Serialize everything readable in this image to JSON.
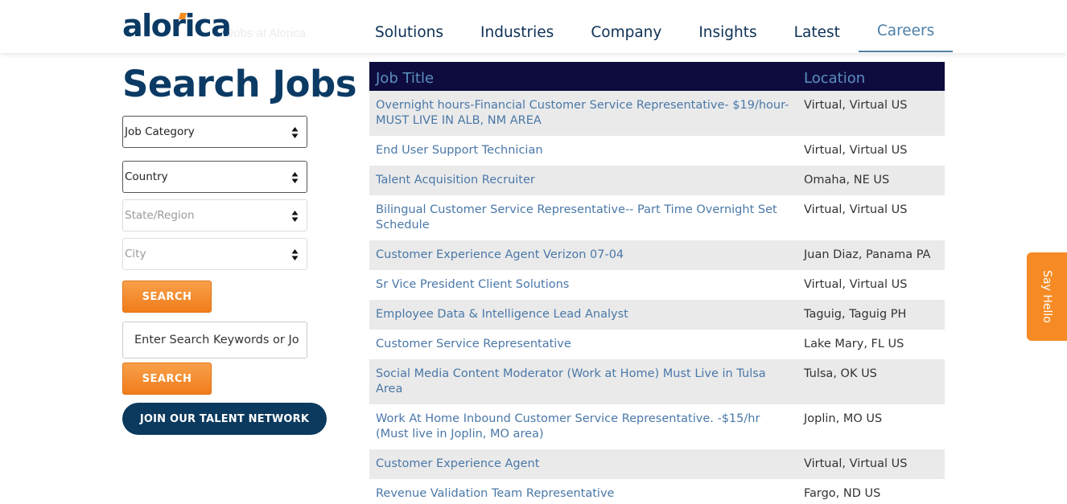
{
  "header": {
    "logo_text": "alorica",
    "ghost_text": "l Jobs at Alorica",
    "nav": [
      {
        "label": "Solutions",
        "active": false
      },
      {
        "label": "Industries",
        "active": false
      },
      {
        "label": "Company",
        "active": false
      },
      {
        "label": "Insights",
        "active": false
      },
      {
        "label": "Latest",
        "active": false
      },
      {
        "label": "Careers",
        "active": true
      }
    ]
  },
  "search": {
    "title": "Search Jobs",
    "job_category": "Job Category",
    "country": "Country",
    "state_region": "State/Region",
    "city": "City",
    "search_button_1": "SEARCH",
    "keyword_value": "Enter Search Keywords or Jo",
    "search_button_2": "SEARCH",
    "talent_button": "JOIN OUR TALENT NETWORK"
  },
  "table": {
    "headers": {
      "title": "Job Title",
      "location": "Location"
    },
    "rows": [
      {
        "title": "Overnight hours-Financial Customer Service Representative- $19/hour- MUST LIVE IN ALB, NM AREA",
        "location": "Virtual, Virtual US"
      },
      {
        "title": "End User Support Technician",
        "location": "Virtual, Virtual US"
      },
      {
        "title": "Talent Acquisition Recruiter",
        "location": "Omaha, NE US"
      },
      {
        "title": "Bilingual Customer Service Representative-- Part Time Overnight Set Schedule",
        "location": "Virtual, Virtual US"
      },
      {
        "title": "Customer Experience Agent Verizon 07-04",
        "location": "Juan Diaz, Panama PA"
      },
      {
        "title": "Sr Vice President Client Solutions",
        "location": "Virtual, Virtual US"
      },
      {
        "title": "Employee Data & Intelligence Lead Analyst",
        "location": "Taguig, Taguig PH"
      },
      {
        "title": "Customer Service Representative",
        "location": "Lake Mary, FL US"
      },
      {
        "title": "Social Media Content Moderator (Work at Home) Must Live in Tulsa Area",
        "location": "Tulsa, OK US"
      },
      {
        "title": "Work At Home Inbound Customer Service Representative. -$15/hr (Must live in Joplin, MO area)",
        "location": "Joplin, MO US"
      },
      {
        "title": "Customer Experience Agent",
        "location": "Virtual, Virtual US"
      },
      {
        "title": "Revenue Validation Team Representative",
        "location": "Fargo, ND US"
      }
    ]
  },
  "say_hello": "Say Hello",
  "colors": {
    "brand_navy": "#0b3a64",
    "accent_orange": "#f58a1f",
    "link_blue": "#4a78a8",
    "table_header_bg": "#0e0c3e"
  }
}
